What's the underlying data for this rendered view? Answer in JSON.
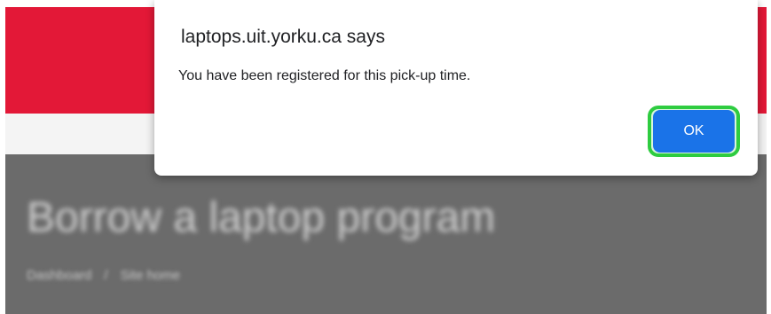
{
  "background_page": {
    "title": "Borrow a laptop program",
    "breadcrumb": {
      "items": [
        "Dashboard",
        "Site home"
      ],
      "separator": "/"
    },
    "colors": {
      "header": "#e31837",
      "body": "#6b6b6b"
    }
  },
  "alert_dialog": {
    "title": "laptops.uit.yorku.ca says",
    "message": "You have been registered for this pick-up time.",
    "ok_label": "OK",
    "colors": {
      "button": "#1a73e8",
      "highlight": "#2ecc40"
    }
  }
}
